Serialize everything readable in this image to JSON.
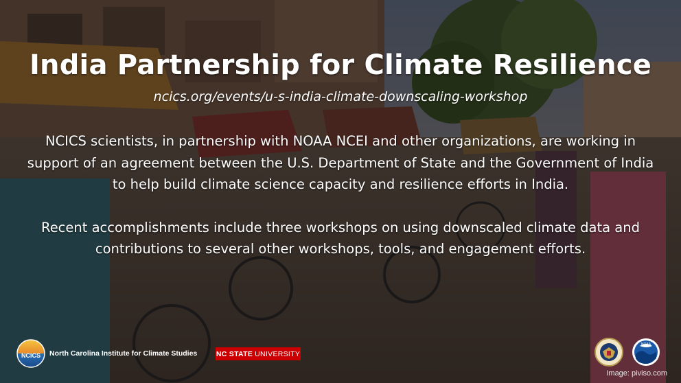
{
  "slide": {
    "title": "India Partnership for Climate Resilience",
    "url": "ncics.org/events/u-s-india-climate-downscaling-workshop",
    "paragraph1": "NCICS scientists, in partnership with NOAA NCEI and other organizations, are working in support of an agreement between the U.S. Department of State and the Government of India to help build climate science capacity and resilience efforts in India.",
    "paragraph2": "Recent accomplishments include three workshops on using downscaled climate data and contributions to several other workshops, tools, and engagement efforts."
  },
  "footer": {
    "ncics_logo_text": "NCICS",
    "ncics_name": "North Carolina Institute for Climate Studies",
    "ncstate_bold": "NC STATE",
    "ncstate_rest": "UNIVERSITY",
    "noaa_logo_text": "NOAA",
    "image_credit": "Image: piviso.com"
  },
  "icons": [
    "ncics-logo-icon",
    "state-department-seal-icon",
    "noaa-logo-icon"
  ]
}
